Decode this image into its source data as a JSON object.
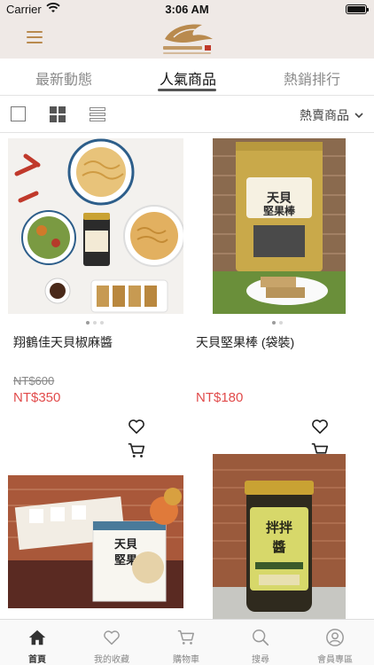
{
  "status_bar": {
    "carrier": "Carrier",
    "time": "3:06 AM"
  },
  "header": {
    "logo_icon": "crane-logo-icon",
    "menu_icon": "hamburger-menu-icon"
  },
  "tabs": [
    {
      "label": "最新動態",
      "active": false
    },
    {
      "label": "人氣商品",
      "active": true
    },
    {
      "label": "熱銷排行",
      "active": false
    }
  ],
  "toolbar": {
    "sort_label": "熱賣商品"
  },
  "products": [
    {
      "name": "翔鶴佳天貝椒麻醬",
      "old_price": "NT$600",
      "price": "NT$350"
    },
    {
      "name": "天貝堅果棒 (袋裝)",
      "old_price": "",
      "price": "NT$180"
    },
    {
      "name": "",
      "old_price": "",
      "price": ""
    },
    {
      "name": "",
      "old_price": "",
      "price": ""
    }
  ],
  "tabbar": [
    {
      "label": "首頁",
      "icon": "home-icon",
      "active": true
    },
    {
      "label": "我的收藏",
      "icon": "heart-icon",
      "active": false
    },
    {
      "label": "購物車",
      "icon": "cart-icon",
      "active": false
    },
    {
      "label": "搜尋",
      "icon": "search-icon",
      "active": false
    },
    {
      "label": "會員專區",
      "icon": "user-icon",
      "active": false
    }
  ],
  "colors": {
    "header_bg": "#efe9e6",
    "accent": "#b98a4e",
    "price": "#e14b4b"
  }
}
